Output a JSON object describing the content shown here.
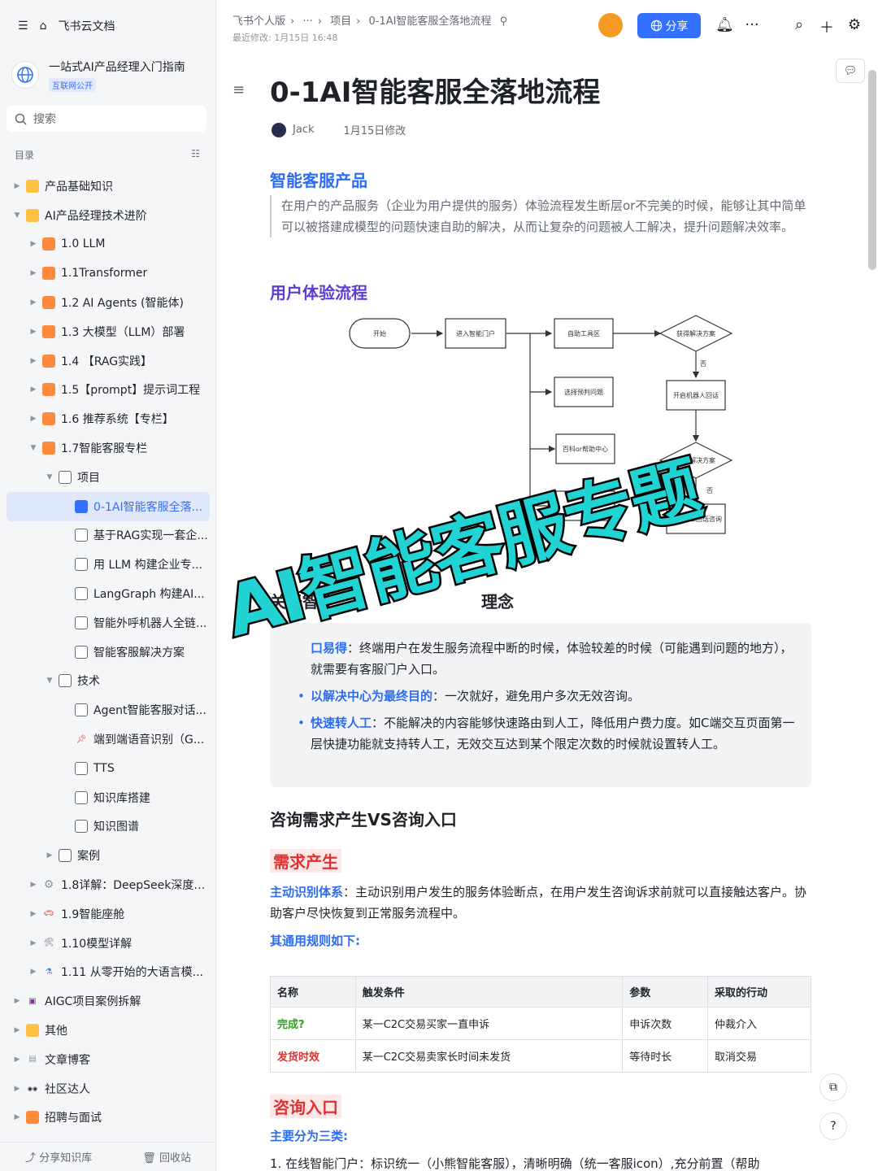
{
  "sidebar": {
    "home_label": "飞书云文档",
    "kb_title": "一站式AI产品经理入门指南",
    "kb_badge": "互联网公开",
    "search_placeholder": "搜索",
    "toc_label": "目录",
    "items": [
      {
        "label": "产品基础知识",
        "level": 0,
        "icon": "folder",
        "arrow": "right"
      },
      {
        "label": "AI产品经理技术进阶",
        "level": 0,
        "icon": "folder",
        "arrow": "down"
      },
      {
        "label": "1.0 LLM",
        "level": 1,
        "icon": "orange",
        "arrow": "right"
      },
      {
        "label": "1.1Transformer",
        "level": 1,
        "icon": "orange",
        "arrow": "right"
      },
      {
        "label": "1.2 AI Agents (智能体)",
        "level": 1,
        "icon": "orange",
        "arrow": "right"
      },
      {
        "label": "1.3 大模型（LLM）部署",
        "level": 1,
        "icon": "orange",
        "arrow": "right"
      },
      {
        "label": "1.4 【RAG实践】",
        "level": 1,
        "icon": "orange",
        "arrow": "right"
      },
      {
        "label": "1.5【prompt】提示词工程",
        "level": 1,
        "icon": "orange",
        "arrow": "right"
      },
      {
        "label": "1.6 推荐系统【专栏】",
        "level": 1,
        "icon": "orange",
        "arrow": "right"
      },
      {
        "label": "1.7智能客服专栏",
        "level": 1,
        "icon": "orange",
        "arrow": "down"
      },
      {
        "label": "项目",
        "level": 2,
        "icon": "doc",
        "arrow": "down"
      },
      {
        "label": "0-1AI智能客服全落...",
        "level": 3,
        "icon": "doc-blue",
        "arrow": "",
        "active": true
      },
      {
        "label": "基于RAG实现一套企...",
        "level": 3,
        "icon": "doc",
        "arrow": ""
      },
      {
        "label": "用 LLM 构建企业专...",
        "level": 3,
        "icon": "doc",
        "arrow": ""
      },
      {
        "label": "LangGraph 构建AI...",
        "level": 3,
        "icon": "doc",
        "arrow": ""
      },
      {
        "label": "智能外呼机器人全链...",
        "level": 3,
        "icon": "doc",
        "arrow": ""
      },
      {
        "label": "智能客服解决方案",
        "level": 3,
        "icon": "doc",
        "arrow": ""
      },
      {
        "label": "技术",
        "level": 2,
        "icon": "doc",
        "arrow": "down"
      },
      {
        "label": "Agent智能客服对话...",
        "level": 3,
        "icon": "doc",
        "arrow": ""
      },
      {
        "label": "端到端语音识别（G...",
        "level": 3,
        "icon": "pin",
        "arrow": ""
      },
      {
        "label": "TTS",
        "level": 3,
        "icon": "doc",
        "arrow": ""
      },
      {
        "label": "知识库搭建",
        "level": 3,
        "icon": "doc",
        "arrow": ""
      },
      {
        "label": "知识图谱",
        "level": 3,
        "icon": "doc",
        "arrow": ""
      },
      {
        "label": "案例",
        "level": 2,
        "icon": "doc",
        "arrow": "right"
      },
      {
        "label": "1.8详解：DeepSeek深度推...",
        "level": 1,
        "icon": "gear",
        "arrow": "right"
      },
      {
        "label": "1.9智能座舱",
        "level": 1,
        "icon": "car",
        "arrow": "right"
      },
      {
        "label": "1.10模型详解",
        "level": 1,
        "icon": "tools",
        "arrow": "right"
      },
      {
        "label": "1.11 从零开始的大语言模...",
        "level": 1,
        "icon": "flask",
        "arrow": "right"
      },
      {
        "label": "AIGC项目案例拆解",
        "level": 0,
        "icon": "save",
        "arrow": "right"
      },
      {
        "label": "其他",
        "level": 0,
        "icon": "folder",
        "arrow": "right"
      },
      {
        "label": "文章博客",
        "level": 0,
        "icon": "blog",
        "arrow": "right"
      },
      {
        "label": "社区达人",
        "level": 0,
        "icon": "eyes",
        "arrow": "right"
      },
      {
        "label": "招聘与面试",
        "level": 0,
        "icon": "orange",
        "arrow": "right"
      }
    ],
    "footer": {
      "share": "分享知识库",
      "trash": "回收站"
    }
  },
  "topbar": {
    "crumbs": [
      "飞书个人版",
      "···",
      "项目",
      "0-1AI智能客服全落地流程"
    ],
    "last_modified": "最近修改: 1月15日 16:48",
    "share_label": "分享"
  },
  "doc": {
    "title": "0-1AI智能客服全落地流程",
    "author": "Jack",
    "modified": "1月15日修改",
    "sec1_title": "智能客服产品",
    "sec1_quote": "在用户的产品服务（企业为用户提供的服务）体验流程发生断层or不完美的时候，能够让其中简单可以被搭建成模型的问题快速自助的解决，从而让复杂的问题被人工解决，提升问题解决效率。",
    "sec2_title": "用户体验流程",
    "flow": {
      "start": "开始",
      "portal": "进入智能门户",
      "self": "自助工具区",
      "solution1": "获得解决方案",
      "no1": "否",
      "select": "选择预判问题",
      "robot": "开启机器人回话",
      "faq": "百科or帮助中心",
      "solution2": "获得解决方案",
      "no2": "否",
      "service": "服务进",
      "human": "选择人工回话咨询"
    },
    "partial_heading": "关于智能",
    "partial_heading_tail": "理念",
    "card": {
      "b1_bold_tail": "口易得",
      "b1_text": "：终端用户在发生服务流程中断的时候，体验较差的时候（可能遇到问题的地方），就需要有客服门户入口。",
      "b2_bold": "以解决中心为最终目的",
      "b2_text": "：一次就好，避免用户多次无效咨询。",
      "b3_bold": "快速转人工",
      "b3_text": "：不能解决的内容能够快速路由到人工，降低用户费力度。如C端交互页面第一层快捷功能就支持转人工，无效交互达到某个限定次数的时候就设置转人工。"
    },
    "sec3_title": "咨询需求产生VS咨询入口",
    "demand_label": "需求产生",
    "demand_bold": "主动识别体系",
    "demand_text": "：主动识别用户发生的服务体验断点，在用户发生咨询诉求前就可以直接触达客户。协助客户尽快恢复到正常服务流程中。",
    "rules_label": "其通用规则如下:",
    "table": {
      "headers": [
        "名称",
        "触发条件",
        "参数",
        "采取的行动"
      ],
      "rows": [
        [
          "完成?",
          "某一C2C交易买家一直申诉",
          "申诉次数",
          "仲裁介入"
        ],
        [
          "发货时效",
          "某一C2C交易卖家长时间未发货",
          "等待时长",
          "取消交易"
        ]
      ]
    },
    "entry_label": "咨询入口",
    "entry_sub": "主要分为三类:",
    "entry_item1": "1.  在线智能门户：标识统一（小熊智能客服），清晰明确（统一客服icon）,充分前置（帮助"
  },
  "overlay_text": "AI智能客服专题"
}
